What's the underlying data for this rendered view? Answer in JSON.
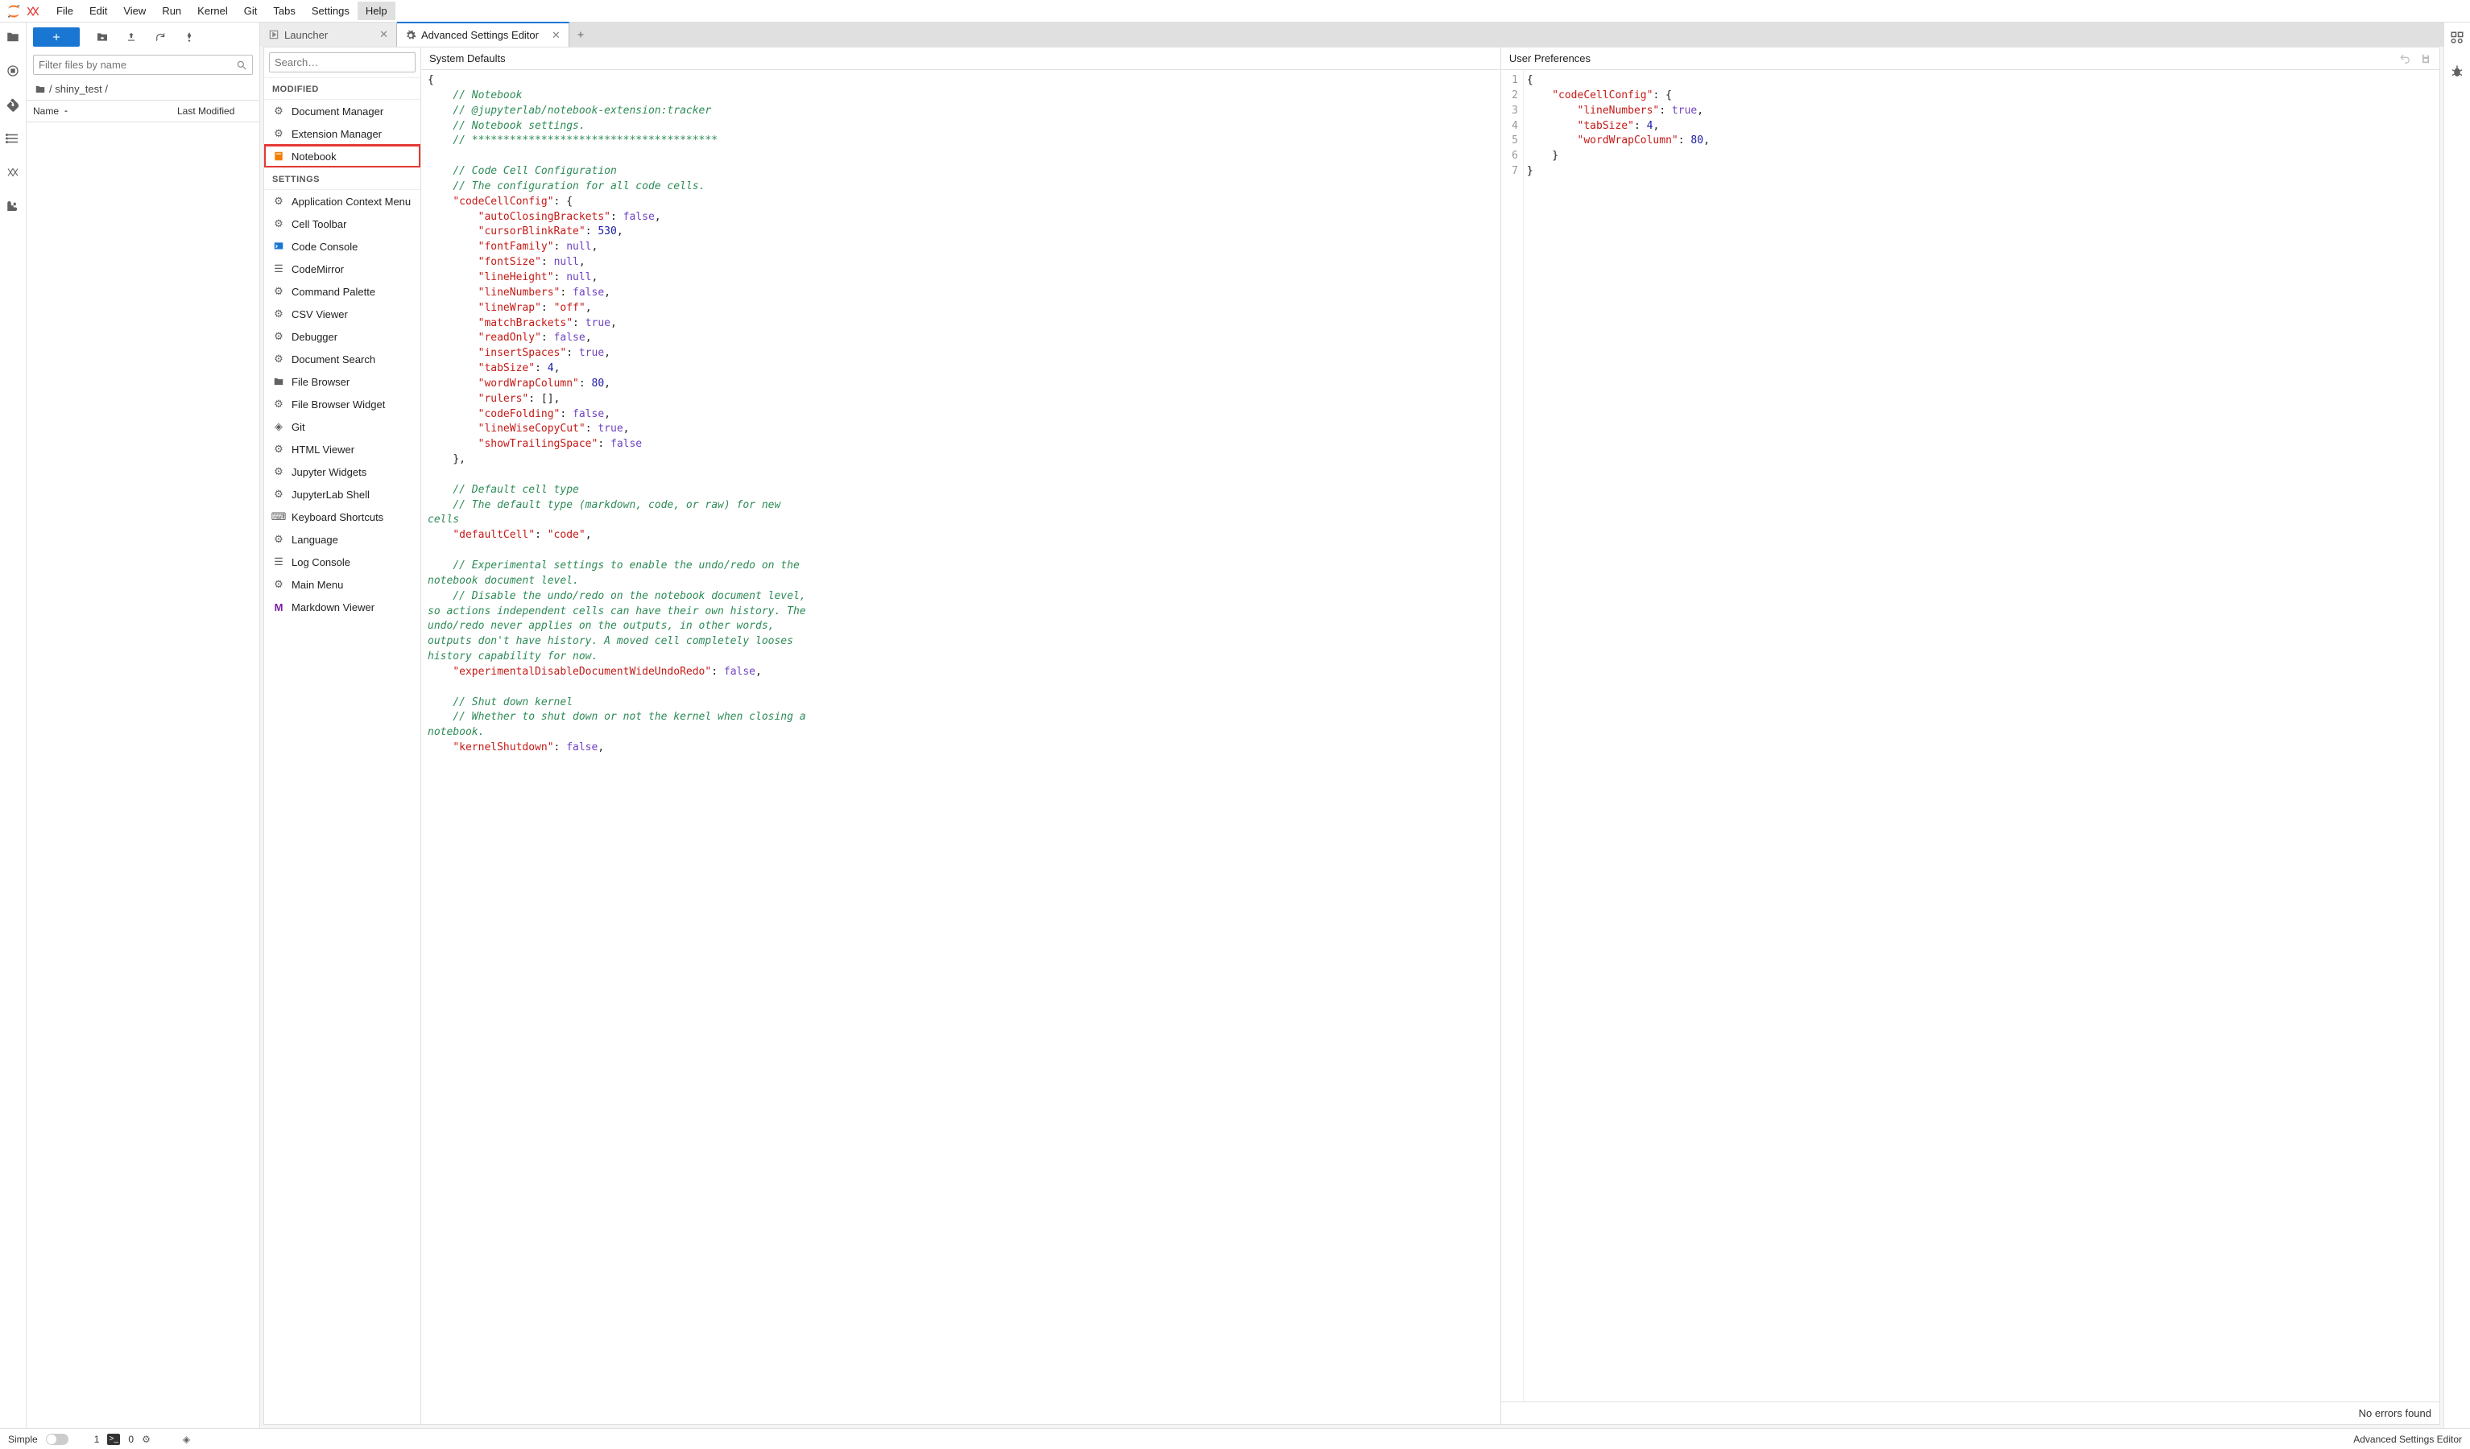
{
  "menubar": {
    "items": [
      "File",
      "Edit",
      "View",
      "Run",
      "Kernel",
      "Git",
      "Tabs",
      "Settings",
      "Help"
    ],
    "active_index": 8
  },
  "filepanel": {
    "filter_placeholder": "Filter files by name",
    "breadcrumb": "/ shiny_test /",
    "col_name": "Name",
    "col_modified": "Last Modified"
  },
  "tabs": {
    "items": [
      {
        "label": "Launcher",
        "active": false
      },
      {
        "label": "Advanced Settings Editor",
        "active": true
      }
    ]
  },
  "settings_list": {
    "search_placeholder": "Search…",
    "section_modified": "MODIFIED",
    "section_settings": "SETTINGS",
    "modified_items": [
      "Document Manager",
      "Extension Manager",
      "Notebook"
    ],
    "highlight_item": "Notebook",
    "settings_items": [
      "Application Context Menu",
      "Cell Toolbar",
      "Code Console",
      "CodeMirror",
      "Command Palette",
      "CSV Viewer",
      "Debugger",
      "Document Search",
      "File Browser",
      "File Browser Widget",
      "Git",
      "HTML Viewer",
      "Jupyter Widgets",
      "JupyterLab Shell",
      "Keyboard Shortcuts",
      "Language",
      "Log Console",
      "Main Menu",
      "Markdown Viewer"
    ]
  },
  "defaults_pane": {
    "title": "System Defaults"
  },
  "user_pane": {
    "title": "User Preferences",
    "status": "No errors found",
    "gutter_lines": [
      "1",
      "2",
      "3",
      "4",
      "5",
      "6",
      "7"
    ]
  },
  "status": {
    "simple": "Simple",
    "num1": "1",
    "num0": "0",
    "right": "Advanced Settings Editor"
  },
  "chart_data": {
    "type": "table",
    "title": "Settings JSON content",
    "system_defaults": {
      "comments": [
        "// Notebook",
        "// @jupyterlab/notebook-extension:tracker",
        "// Notebook settings.",
        "// ***************************************",
        "// Code Cell Configuration",
        "// The configuration for all code cells.",
        "// Default cell type",
        "// The default type (markdown, code, or raw) for new cells",
        "// Experimental settings to enable the undo/redo on the notebook document level.",
        "// Disable the undo/redo on the notebook document level, so actions independent cells can have their own history. The undo/redo never applies on the outputs, in other words, outputs don't have history. A moved cell completely looses history capability for now.",
        "// Shut down kernel",
        "// Whether to shut down or not the kernel when closing a notebook."
      ],
      "codeCellConfig": {
        "autoClosingBrackets": false,
        "cursorBlinkRate": 530,
        "fontFamily": null,
        "fontSize": null,
        "lineHeight": null,
        "lineNumbers": false,
        "lineWrap": "off",
        "matchBrackets": true,
        "readOnly": false,
        "insertSpaces": true,
        "tabSize": 4,
        "wordWrapColumn": 80,
        "rulers": [],
        "codeFolding": false,
        "lineWiseCopyCut": true,
        "showTrailingSpace": false
      },
      "defaultCell": "code",
      "experimentalDisableDocumentWideUndoRedo": false,
      "kernelShutdown": false
    },
    "user_preferences": {
      "codeCellConfig": {
        "lineNumbers": true,
        "tabSize": 4,
        "wordWrapColumn": 80
      }
    }
  }
}
